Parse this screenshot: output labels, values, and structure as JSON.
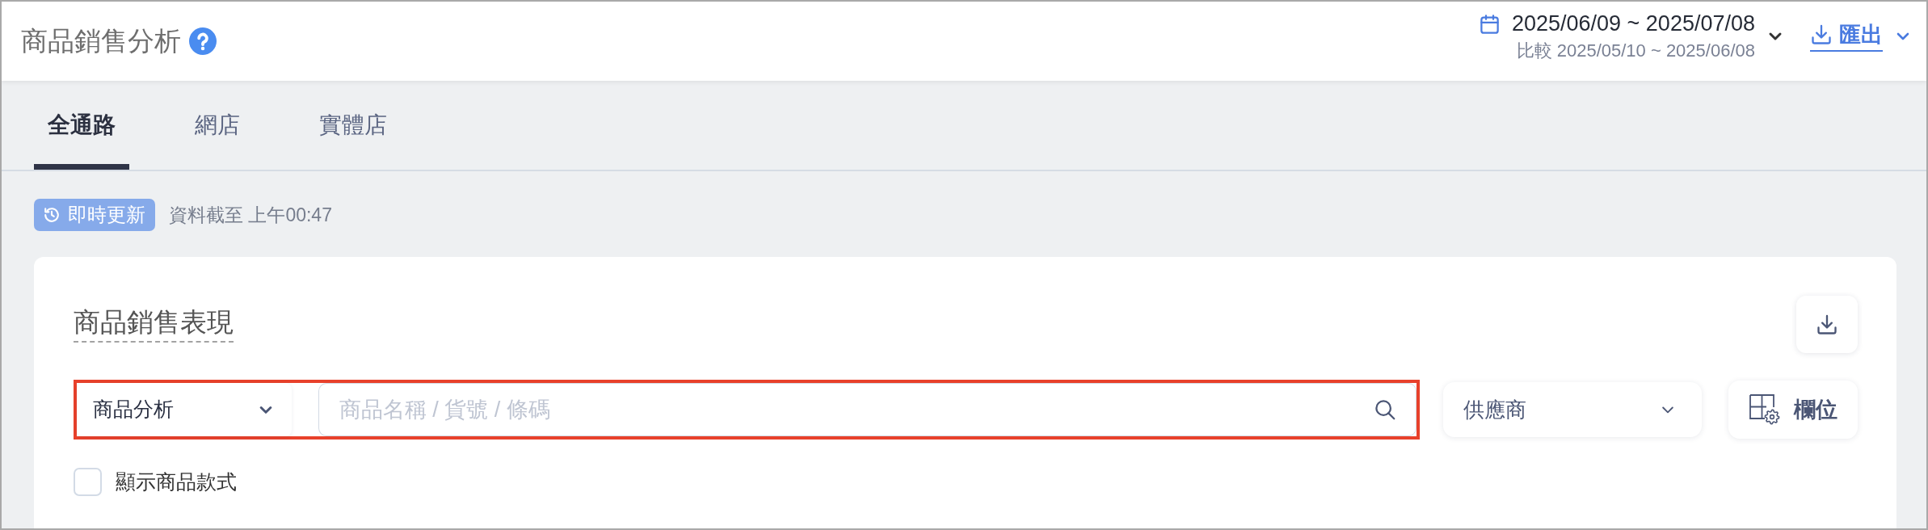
{
  "header": {
    "title": "商品銷售分析",
    "date_range": "2025/06/09 ~ 2025/07/08",
    "compare_range": "比較 2025/05/10 ~ 2025/06/08",
    "export_label": "匯出"
  },
  "tabs": [
    {
      "label": "全通路",
      "selected": true
    },
    {
      "label": "網店",
      "selected": false
    },
    {
      "label": "實體店",
      "selected": false
    }
  ],
  "update_status": {
    "badge": "即時更新",
    "note": "資料截至 上午00:47"
  },
  "panel": {
    "title": "商品銷售表現",
    "search_group": {
      "highlighted": true,
      "scope": "商品分析",
      "placeholder": "商品名稱 / 貨號 / 條碼"
    },
    "supplier": "供應商",
    "columns_button": "欄位",
    "show_variants": {
      "label": "顯示商品款式",
      "checked": false
    }
  }
}
